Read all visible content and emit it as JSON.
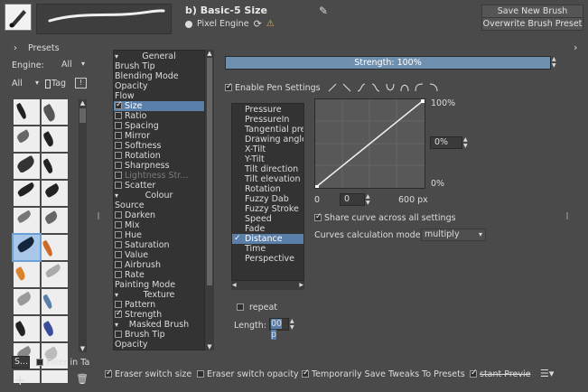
{
  "header": {
    "title": "b) Basic-5 Size",
    "engine_label": "Pixel Engine",
    "save_new_label": "Save New Brush Preset...",
    "overwrite_label": "Overwrite Brush Preset"
  },
  "presets": {
    "title": "Presets",
    "engine_label": "Engine:",
    "engine_value": "All",
    "filter_all": "All",
    "tag_label": "Tag",
    "search_placeholder": "S...",
    "filter_in_tag": "Filter in Ta"
  },
  "options_list": [
    {
      "label": "General",
      "type": "section"
    },
    {
      "label": "Brush Tip",
      "type": "plain"
    },
    {
      "label": "Blending Mode",
      "type": "plain"
    },
    {
      "label": "Opacity",
      "type": "plain"
    },
    {
      "label": "Flow",
      "type": "plain"
    },
    {
      "label": "Size",
      "type": "check",
      "checked": true,
      "selected": true
    },
    {
      "label": "Ratio",
      "type": "check",
      "checked": false
    },
    {
      "label": "Spacing",
      "type": "check",
      "checked": false
    },
    {
      "label": "Mirror",
      "type": "check",
      "checked": false
    },
    {
      "label": "Softness",
      "type": "check",
      "checked": false
    },
    {
      "label": "Rotation",
      "type": "check",
      "checked": false
    },
    {
      "label": "Sharpness",
      "type": "check",
      "checked": false
    },
    {
      "label": "Lightness Str...",
      "type": "check",
      "checked": false,
      "disabled": true
    },
    {
      "label": "Scatter",
      "type": "check",
      "checked": false
    },
    {
      "label": "Colour",
      "type": "section"
    },
    {
      "label": "Source",
      "type": "plain"
    },
    {
      "label": "Darken",
      "type": "check",
      "checked": false
    },
    {
      "label": "Mix",
      "type": "check",
      "checked": false
    },
    {
      "label": "Hue",
      "type": "check",
      "checked": false
    },
    {
      "label": "Saturation",
      "type": "check",
      "checked": false
    },
    {
      "label": "Value",
      "type": "check",
      "checked": false
    },
    {
      "label": "Airbrush",
      "type": "check",
      "checked": false
    },
    {
      "label": "Rate",
      "type": "check",
      "checked": false
    },
    {
      "label": "Painting Mode",
      "type": "plain"
    },
    {
      "label": "Texture",
      "type": "section"
    },
    {
      "label": "Pattern",
      "type": "check",
      "checked": false
    },
    {
      "label": "Strength",
      "type": "check",
      "checked": true
    },
    {
      "label": "Masked Brush",
      "type": "section"
    },
    {
      "label": "Brush Tip",
      "type": "check",
      "checked": false
    },
    {
      "label": "Opacity",
      "type": "plain"
    }
  ],
  "strength": {
    "label": "Strength: 100%",
    "fraction": 1.0
  },
  "pen_settings_label": "Enable Pen Settings",
  "sensors": [
    {
      "label": "Pressure",
      "checked": false
    },
    {
      "label": "PressureIn",
      "checked": false
    },
    {
      "label": "Tangential pres",
      "checked": false
    },
    {
      "label": "Drawing angle",
      "checked": false
    },
    {
      "label": "X-Tilt",
      "checked": false
    },
    {
      "label": "Y-Tilt",
      "checked": false
    },
    {
      "label": "Tilt direction",
      "checked": false
    },
    {
      "label": "Tilt elevation",
      "checked": false
    },
    {
      "label": "Rotation",
      "checked": false
    },
    {
      "label": "Fuzzy Dab",
      "checked": false
    },
    {
      "label": "Fuzzy Stroke",
      "checked": false
    },
    {
      "label": "Speed",
      "checked": false
    },
    {
      "label": "Fade",
      "checked": false
    },
    {
      "label": "Distance",
      "checked": true,
      "selected": true
    },
    {
      "label": "Time",
      "checked": false
    },
    {
      "label": "Perspective",
      "checked": false
    }
  ],
  "curve": {
    "top_label": "100%",
    "mid_value": "0%",
    "bottom_label": "0%",
    "x_start": "0",
    "x_value": "0",
    "x_end": "600 px",
    "share_label": "Share curve across all settings",
    "calc_label": "Curves calculation mode:",
    "calc_value": "multiply"
  },
  "repeat_label": "repeat",
  "length_label": "Length:",
  "length_value": "00 p",
  "footer": {
    "eraser_size": "Eraser switch size",
    "eraser_opacity": "Eraser switch opacity",
    "temp_save": "Temporarily Save Tweaks To Presets",
    "instant_preview": "stant Previe"
  }
}
